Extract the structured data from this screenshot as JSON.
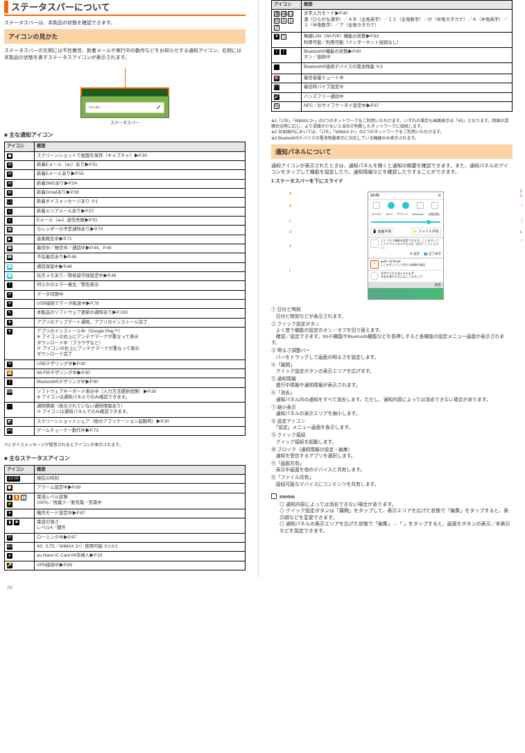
{
  "page_number": "28",
  "col1": {
    "title": "ステータスバーについて",
    "body1": "ステータスバーは、本製品の状態を確認できます。",
    "strip": "アイコンの見かた",
    "body2": "ステータスバーの左側には不在着信、新着メールや実行中の動作などをお知らせする通知アイコン、右側には本製品の状態を表すステータスアイコンが表示されます。",
    "caption_statusbar": "ステータスバー",
    "sub_notif": "■ 主な通知アイコン",
    "table_header": {
      "icon": "アイコン",
      "desc": "概要"
    },
    "notif_rows": [
      {
        "ic": [
          "person"
        ],
        "desc": "スクリーンショットで画面を保存（キャプチャ）▶P.30"
      },
      {
        "ic": [
          "env"
        ],
        "desc": "新着Eメール（au）あり▶P.51"
      },
      {
        "ic": [
          "env2"
        ],
        "desc": "新着Eメールあり▶P.55"
      },
      {
        "ic": [
          "sms"
        ],
        "desc": "新着SMSあり▶P.54"
      },
      {
        "ic": [
          "gmail"
        ],
        "desc": "新着Gmailあり▶P.56"
      },
      {
        "ic": [
          "voice"
        ],
        "desc": "新着ボイスメッセージあり ※1"
      },
      {
        "ic": [
          "err"
        ],
        "desc": "新着エリアメールあり▶P.57"
      },
      {
        "ic": [
          "err2"
        ],
        "desc": "Eメール（au）送信失敗▶P.51"
      },
      {
        "ic": [
          "cal"
        ],
        "desc": "カレンダーの予定通知あり▶P.70"
      },
      {
        "ic": [
          "play"
        ],
        "desc": "音楽再生中▶P.71"
      },
      {
        "ic": [
          "phone"
        ],
        "desc": "着信中／発信中／通話中▶P.44、P.45"
      },
      {
        "ic": [
          "phone-x"
        ],
        "desc": "不在着信あり▶P.46"
      },
      {
        "ic": [
          "phone-t1"
        ],
        "desc": "通話保留中▶P.46"
      },
      {
        "ic": [
          "phone-t2"
        ],
        "desc": "伝言メモあり／簡易留守録設定中▶P.46"
      },
      {
        "ic": [
          "warn"
        ],
        "desc": "何らかのエラー発生／警告表示"
      },
      {
        "ic": [
          "sync"
        ],
        "desc": "データ同期中"
      },
      {
        "ic": [
          "usb"
        ],
        "desc": "USB接続でデータ転送中▶P.78"
      },
      {
        "ic": [
          "update"
        ],
        "desc": "本製品のソフトウェア更新の通知あり▶P.100"
      },
      {
        "ic": [
          "dl"
        ],
        "desc": "アプリのアップデート通知、アプリのインストール完了"
      },
      {
        "ic": [
          "dl2"
        ],
        "desc": "アプリのインストール中（Google Play™）\n※ アイコンの右上にアンテナマークが重なって表示\nダウンロード中（ブラウザなど）\n※ アイコンの右上にアンテナマークが重なって表示\nダウンロード完了"
      },
      {
        "ic": [
          "tether"
        ],
        "desc": "USBテザリング中▶P.90"
      },
      {
        "ic": [
          "wifi-t"
        ],
        "desc": "Wi-Fi®テザリング中▶P.90"
      },
      {
        "ic": [
          "bt-t"
        ],
        "desc": "Bluetooth®テザリング中▶P.90"
      },
      {
        "ic": [
          "kbd"
        ],
        "desc": "ソフトウェアキーボード表示中（入力方法選択状態）▶P.38\n※ アイコンは通知パネルでのみ確認できます。"
      },
      {
        "ic": [
          "dots"
        ],
        "desc": "通知情報（表示されていない通知情報あり）\n※ アイコンは通知パネルでのみ確認できます。"
      },
      {
        "ic": [
          "shot"
        ],
        "desc": "スクリーンショットシェア（他のアプリケーション起動時）▶P.30"
      },
      {
        "ic": [
          "game"
        ],
        "desc": "ゲームチューナー動作中▶P.73"
      }
    ],
    "foot1": "※1 ボイスメッセージが録音されるとアイコンが表示されます。",
    "sub_status": "■ 主なステータスアイコン",
    "status_rows1": [
      {
        "ic": [
          "clock"
        ],
        "text": "10:00",
        "desc": "現在の時刻"
      },
      {
        "ic": [
          "alarm"
        ],
        "desc": "アラーム設定中▶P.69"
      },
      {
        "ic": [
          "b1",
          "b2",
          "b3",
          "b4"
        ],
        "desc": "電池レベル状態\n100％／残量少／要充電／充電中"
      },
      {
        "ic": [
          "plane"
        ],
        "desc": "機内モード設定中▶P.87"
      },
      {
        "ic": [
          "sig1",
          "sig2"
        ],
        "desc": "電波の強さ\nレベル4／圏外"
      },
      {
        "ic": [
          "r"
        ],
        "desc": "ローミング中▶P.97"
      },
      {
        "ic": [
          "4g"
        ],
        "desc": "4G（LTE／WiMAX 2+）使用可能 ※1※2"
      },
      {
        "ic": [
          "nosim"
        ],
        "desc": "au Nano IC Card 04未挿入▶P.19"
      },
      {
        "ic": [
          "vpn"
        ],
        "desc": "VPN接続中▶P.89"
      }
    ]
  },
  "col2": {
    "status_rows2": [
      {
        "ic": [
          "ab",
          "ab2",
          "ab3",
          "ab4",
          "ab5",
          "ab6",
          "ab7"
        ],
        "desc": "文字入力モード▶P.40\n漢（ひらがな漢字）／ＡＢ（全角英字）／１２（全角数字）／ｶﾅ（半角カタカナ）／Ａ（半角英字）／１（半角数字）／ア（全角カタカナ）"
      },
      {
        "ic": [
          "wifi1",
          "wifi2"
        ],
        "desc": "無線LAN（Wi-Fi®）機能の状態▶P.82\n利用可能／利用可能（インターネット接続なし）"
      },
      {
        "ic": [
          "bt1",
          "bt2"
        ],
        "desc": "Bluetooth®機能の状態▶P.80\nオン／接続中"
      },
      {
        "ic": [
          "empty"
        ],
        "desc": "Bluetooth®接続デバイスの電池残量 ※3"
      },
      {
        "ic": [
          "mute"
        ],
        "desc": "着信音量ミュート中"
      },
      {
        "ic": [
          "vib"
        ],
        "desc": "着信時バイブ設定中"
      },
      {
        "ic": [
          "hf"
        ],
        "desc": "ハンズフリー通話中"
      },
      {
        "ic": [
          "nfc"
        ],
        "desc": "NFC／おサイフケータイ設定中▶P.67"
      }
    ],
    "foot2": "※1「LTE」「WiMAX 2+」の2つのネットワークをご利用いただけます。いずれの場合も画面表示は「4G」となります。回線の混雑状況等に応じ、より混雑が少ないと当社が判断したネットワークに接続します。\n※2 日本国内においては、「LTE」「WiMAX 2+」の2つのネットワークをご利用いただけます。\n※3 Bluetooth®デバイスの電池残量表示に対応している機器のみ表示されます。",
    "strip": "通知パネルについて",
    "body": "通知アイコンが表示されたときは、通知パネルを開くと通知の概要を確認できます。また、通知パネルのアイコンをタップして機能を設定したり、通知情報などを確認したりすることができます。",
    "step": "1 ステータスバーを下にスライド",
    "labels": {
      "a": "a",
      "b": "b",
      "c": "c",
      "d": "d",
      "e": "e",
      "f": "f",
      "g": "g",
      "h": "h",
      "i": "i",
      "j": "j",
      "k": "k",
      "l": "l"
    },
    "panel_items": [
      "① 日付と時刻\n　日付と時刻などが表示されます。",
      "② クイック設定ボタン\n　よく使う機能の設定のオン／オフを切り替えます。\n　確認／設定できます。Wi-Fi機能やBluetooth機能などを長押しすると各機能の設定メニュー画面が表示されます。",
      "③ 明るさ調整バー\n　バーをドラッグして画面の明るさを設定します。",
      "④「展開」\n　クイック設定ボタンの表示エリアを広げます。",
      "⑤ 通知情報\n　進行中情報や通知情報が表示されます。",
      "⑥「消去」\n　通知パネル内の通知をすべて消去します。ただし、通知内容によっては消去できない場合があります。",
      "⑦ 縮小表示\n　通知パネルの表示エリアを縮小します。",
      "⑧ 設定アイコン\n　「設定」メニュー画面を表示します。",
      "⑨ クイック接続\n　クイック接続を起動します。",
      "⑩ ブロック（通知情報の設定・編集）\n　通知を受信するアプリを選択します。",
      "⑪「画面共有」\n　表示中画面を他のデバイスと共有します。",
      "⑫「ファイル共有」\n　接続可能なデバイスにコンテンツを共有します。"
    ],
    "note_title": "memo",
    "notes": [
      "通知内容によっては消去できない場合があります。",
      "クイック設定ボタンは「展開」をタップして、表示エリアを広げた状態で「編集」をタップすると、表示順などを変更できます。",
      "通知パネルの表示エリアを広げた状態で「編集」→「 」をタップすると、画面をボタンの表示／非表示などを設定できます。"
    ]
  }
}
